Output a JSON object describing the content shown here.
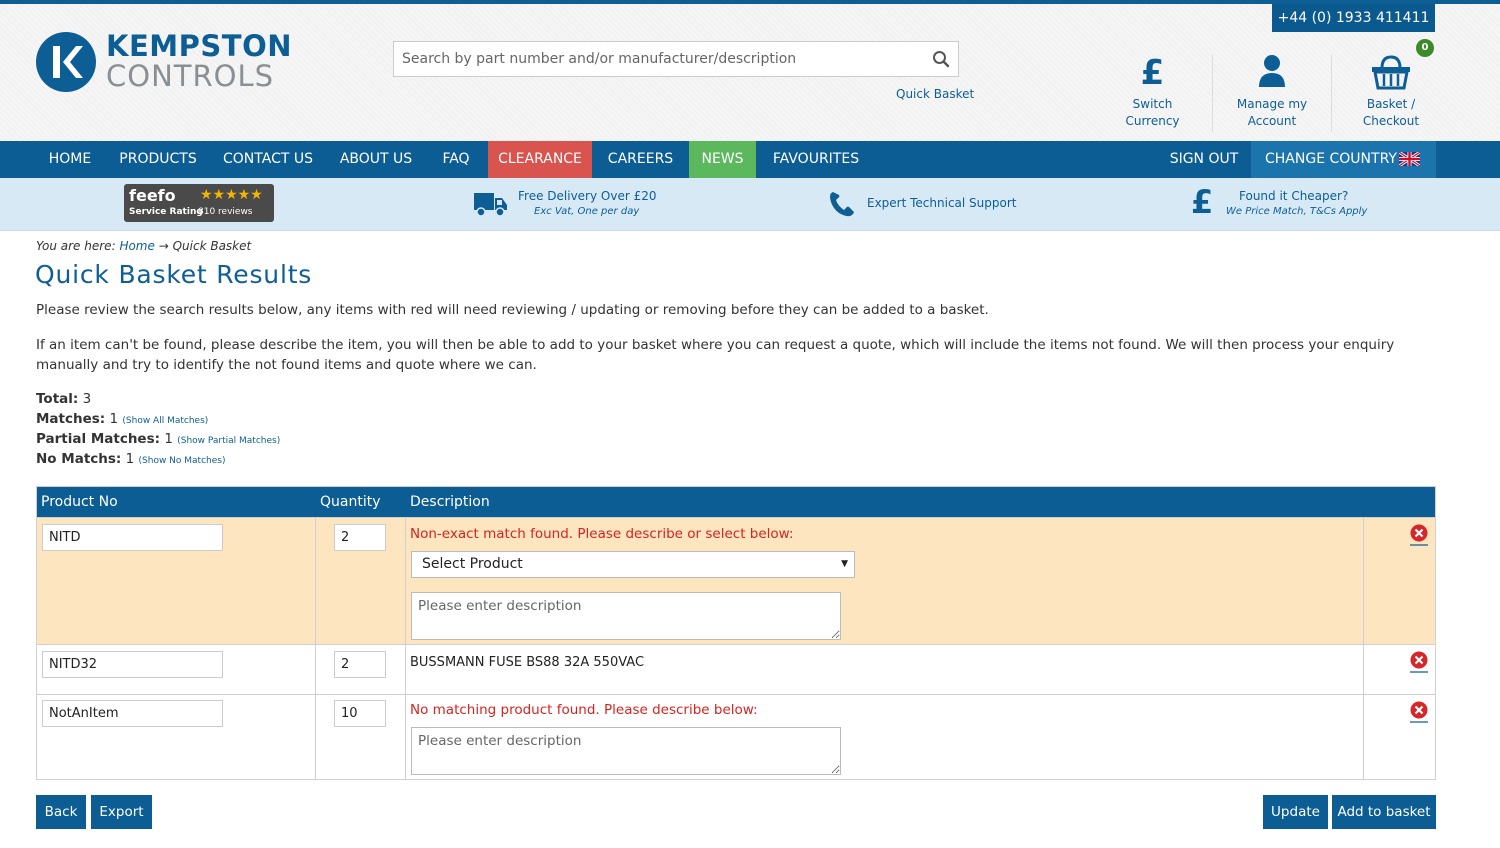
{
  "header": {
    "phone": "+44 (0) 1933 411411",
    "logo": {
      "line1": "KEMPSTON",
      "line2": "CONTROLS"
    },
    "search_placeholder": "Search by part number and/or manufacturer/description",
    "quick_basket_link": "Quick Basket",
    "currency_symbol": "£",
    "switch_currency": "Switch Currency",
    "account_line1": "Manage my",
    "account_line2": "Account",
    "basket_line1": "Basket /",
    "basket_line2": "Checkout",
    "basket_count": "0"
  },
  "nav": {
    "items": [
      "HOME",
      "PRODUCTS",
      "CONTACT US",
      "ABOUT US",
      "FAQ",
      "CLEARANCE",
      "CAREERS",
      "NEWS",
      "FAVOURITES"
    ],
    "sign_out": "SIGN OUT",
    "change_country": "CHANGE COUNTRY"
  },
  "usp": {
    "feefo_logo": "feefo",
    "feefo_stars": "★★★★★",
    "feefo_rating_label": "Service Rating",
    "feefo_reviews": "810 reviews",
    "delivery_title": "Free Delivery Over £20",
    "delivery_sub": "Exc Vat, One per day",
    "support_title": "Expert Technical Support",
    "cheaper_symbol": "£",
    "cheaper_title": "Found it Cheaper?",
    "cheaper_sub": "We Price Match, T&Cs Apply"
  },
  "breadcrumb": {
    "prefix": "You are here:",
    "home": "Home",
    "arrow": "→",
    "current": "Quick Basket"
  },
  "page": {
    "title": "Quick Basket Results",
    "para1": "Please review the search results below, any items with red will need reviewing / updating or removing before they can be added to a basket.",
    "para2": "If an item can't be found, please describe the item, you will then be able to add to your basket where you can request a quote, which will include the items not found. We will then process your enquiry manually and try to identify the not found items and quote where we can."
  },
  "stats": {
    "total_label": "Total:",
    "total": "3",
    "matches_label": "Matches:",
    "matches": "1",
    "matches_link": "(Show All Matches)",
    "partial_label": "Partial Matches:",
    "partial": "1",
    "partial_link": "(Show Partial Matches)",
    "none_label": "No Matchs:",
    "none": "1",
    "none_link": "(Show No Matches)"
  },
  "table": {
    "headers": {
      "product": "Product No",
      "quantity": "Quantity",
      "description": "Description"
    },
    "rows": [
      {
        "product": "NITD",
        "quantity": "2",
        "message": "Non-exact match found. Please describe or select below:",
        "select": "Select Product",
        "desc_placeholder": "Please enter description"
      },
      {
        "product": "NITD32",
        "quantity": "2",
        "description": "BUSSMANN FUSE BS88 32A 550VAC"
      },
      {
        "product": "NotAnItem",
        "quantity": "10",
        "message": "No matching product found. Please describe below:",
        "desc_placeholder": "Please enter description"
      }
    ]
  },
  "buttons": {
    "back": "Back",
    "export": "Export",
    "update": "Update",
    "add": "Add to basket"
  },
  "colors": {
    "brand": "#0b5d94",
    "clearance": "#d9534f",
    "news": "#5cb85c",
    "partial_row": "#fde5c0",
    "error": "#d9231e"
  }
}
